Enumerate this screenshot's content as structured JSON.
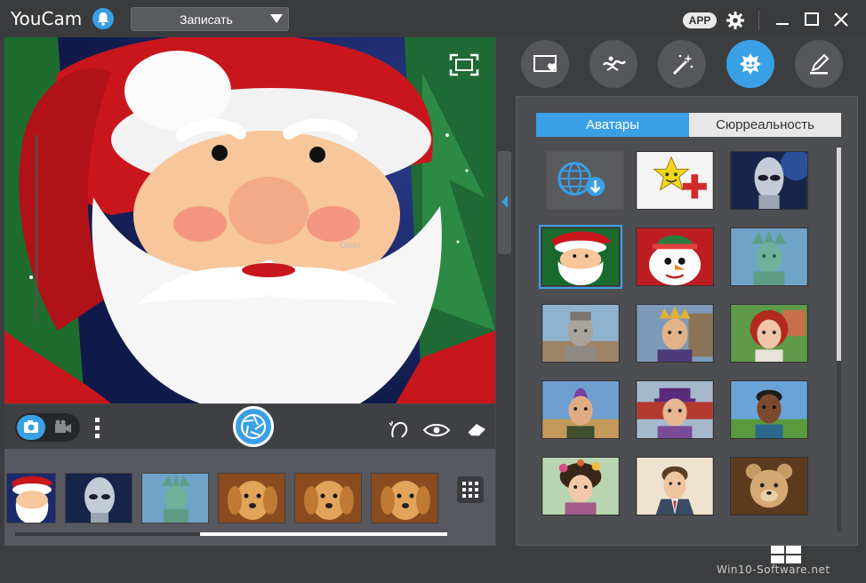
{
  "app": {
    "title": "YouCam"
  },
  "toolbar": {
    "record_label": "Записать",
    "app_badge": "APP"
  },
  "preview": {
    "overlay_text": "Окно"
  },
  "panel": {
    "tabs": [
      "frame",
      "particle",
      "magic-wand",
      "avatar",
      "draw"
    ],
    "active_tab": "avatar",
    "segments": [
      "Аватары",
      "Сюрреальность"
    ],
    "active_segment": "Аватары"
  },
  "watermark": "Win10-Software.net",
  "colors": {
    "accent": "#3aa0e6",
    "background": "#3c3d3f",
    "panel": "#4d4e51"
  }
}
